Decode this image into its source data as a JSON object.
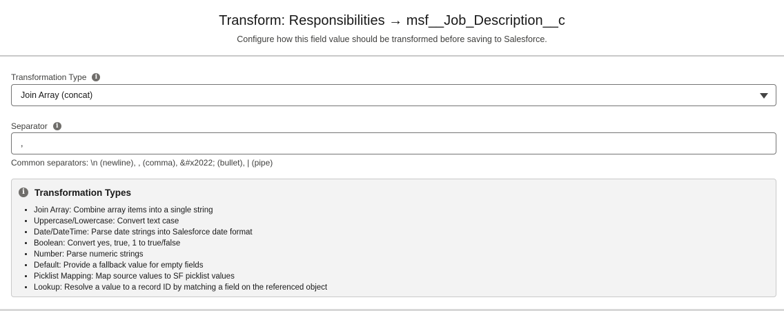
{
  "modal": {
    "title": "Transform: Responsibilities → msf__Job_Description__c",
    "subtitle": "Configure how this field value should be transformed before saving to Salesforce."
  },
  "transformation_type": {
    "label": "Transformation Type",
    "info_icon": "info-icon",
    "selected": "Join Array (concat)",
    "arrow_icon": "chevron-down-icon"
  },
  "separator": {
    "label": "Separator",
    "info_icon": "info-icon",
    "value": ",",
    "help_text": "Common separators: \\n (newline), , (comma), &#x2022; (bullet), | (pipe)"
  },
  "info_box": {
    "icon": "info-icon",
    "title": "Transformation Types",
    "items": [
      "Join Array: Combine array items into a single string",
      "Uppercase/Lowercase: Convert text case",
      "Date/DateTime: Parse date strings into Salesforce date format",
      "Boolean: Convert yes, true, 1 to true/false",
      "Number: Parse numeric strings",
      "Default: Provide a fallback value for empty fields",
      "Picklist Mapping: Map source values to SF picklist values",
      "Lookup: Resolve a value to a record ID by matching a field on the referenced object"
    ]
  },
  "colors": {
    "border": "#747474",
    "info_bg": "#f3f3f3",
    "icon_gray": "#706e6b"
  }
}
